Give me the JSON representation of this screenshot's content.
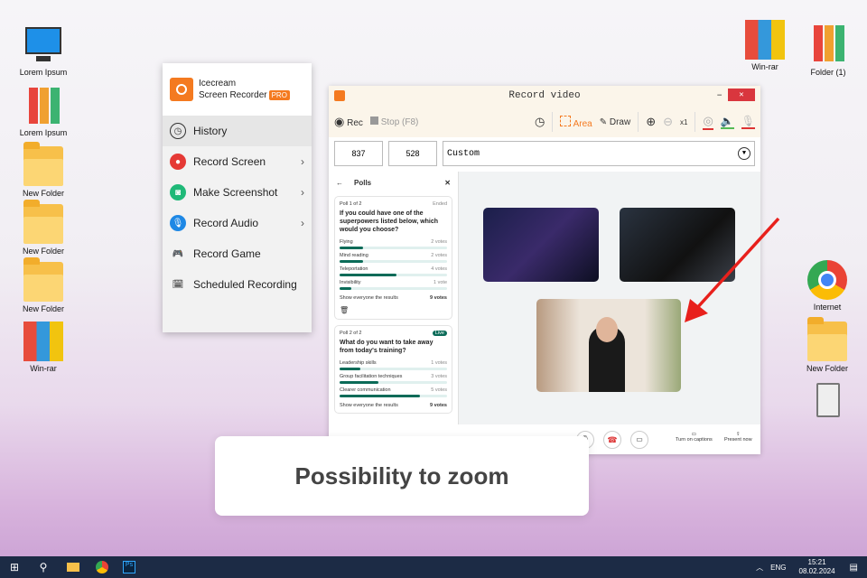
{
  "desktop": {
    "left_icons": [
      "Lorem Ipsum",
      "Lorem Ipsum",
      "New Folder",
      "New Folder",
      "New Folder",
      "Win-rar"
    ],
    "right_icons": [
      "Win-rar",
      "Folder (1)",
      "Internet",
      "New Folder"
    ]
  },
  "menu": {
    "brand_line1": "Icecream",
    "brand_line2": "Screen Recorder",
    "badge": "PRO",
    "items": [
      {
        "label": "History"
      },
      {
        "label": "Record Screen"
      },
      {
        "label": "Make Screenshot"
      },
      {
        "label": "Record Audio"
      },
      {
        "label": "Record Game"
      },
      {
        "label": "Scheduled Recording"
      }
    ]
  },
  "recorder": {
    "title": "Record video",
    "rec": "Rec",
    "stop": "Stop (F8)",
    "area": "Area",
    "draw": "Draw",
    "zoom_level": "x1",
    "width": "837",
    "height": "528",
    "preset": "Custom"
  },
  "polls": {
    "title": "Polls",
    "poll1": {
      "label": "Poll 1 of 2",
      "status": "Ended",
      "question": "If you could have one of the superpowers listed below, which would you choose?",
      "options": [
        {
          "name": "Flying",
          "votes": "2 votes",
          "pct": 22
        },
        {
          "name": "Mind reading",
          "votes": "2 votes",
          "pct": 22
        },
        {
          "name": "Teleportation",
          "votes": "4 votes",
          "pct": 53
        },
        {
          "name": "Invisibility",
          "votes": "1 vote",
          "pct": 11
        }
      ],
      "show_results": "Show everyone the results",
      "total": "9 votes"
    },
    "poll2": {
      "label": "Poll 2 of 2",
      "status": "Live",
      "question": "What do you want to take away from today's training?",
      "options": [
        {
          "name": "Leadership skills",
          "votes": "1 votes",
          "pct": 19
        },
        {
          "name": "Group facilitation techniques",
          "votes": "3 votes",
          "pct": 36
        },
        {
          "name": "Clearer communication",
          "votes": "5 votes",
          "pct": 75
        }
      ],
      "show_results": "Show everyone the results",
      "total": "9 votes"
    }
  },
  "meeting": {
    "captions": "Turn on captions",
    "present": "Present now"
  },
  "caption": "Possibility to zoom",
  "taskbar": {
    "lang": "ENG",
    "time": "15:21",
    "date": "08.02.2024"
  }
}
